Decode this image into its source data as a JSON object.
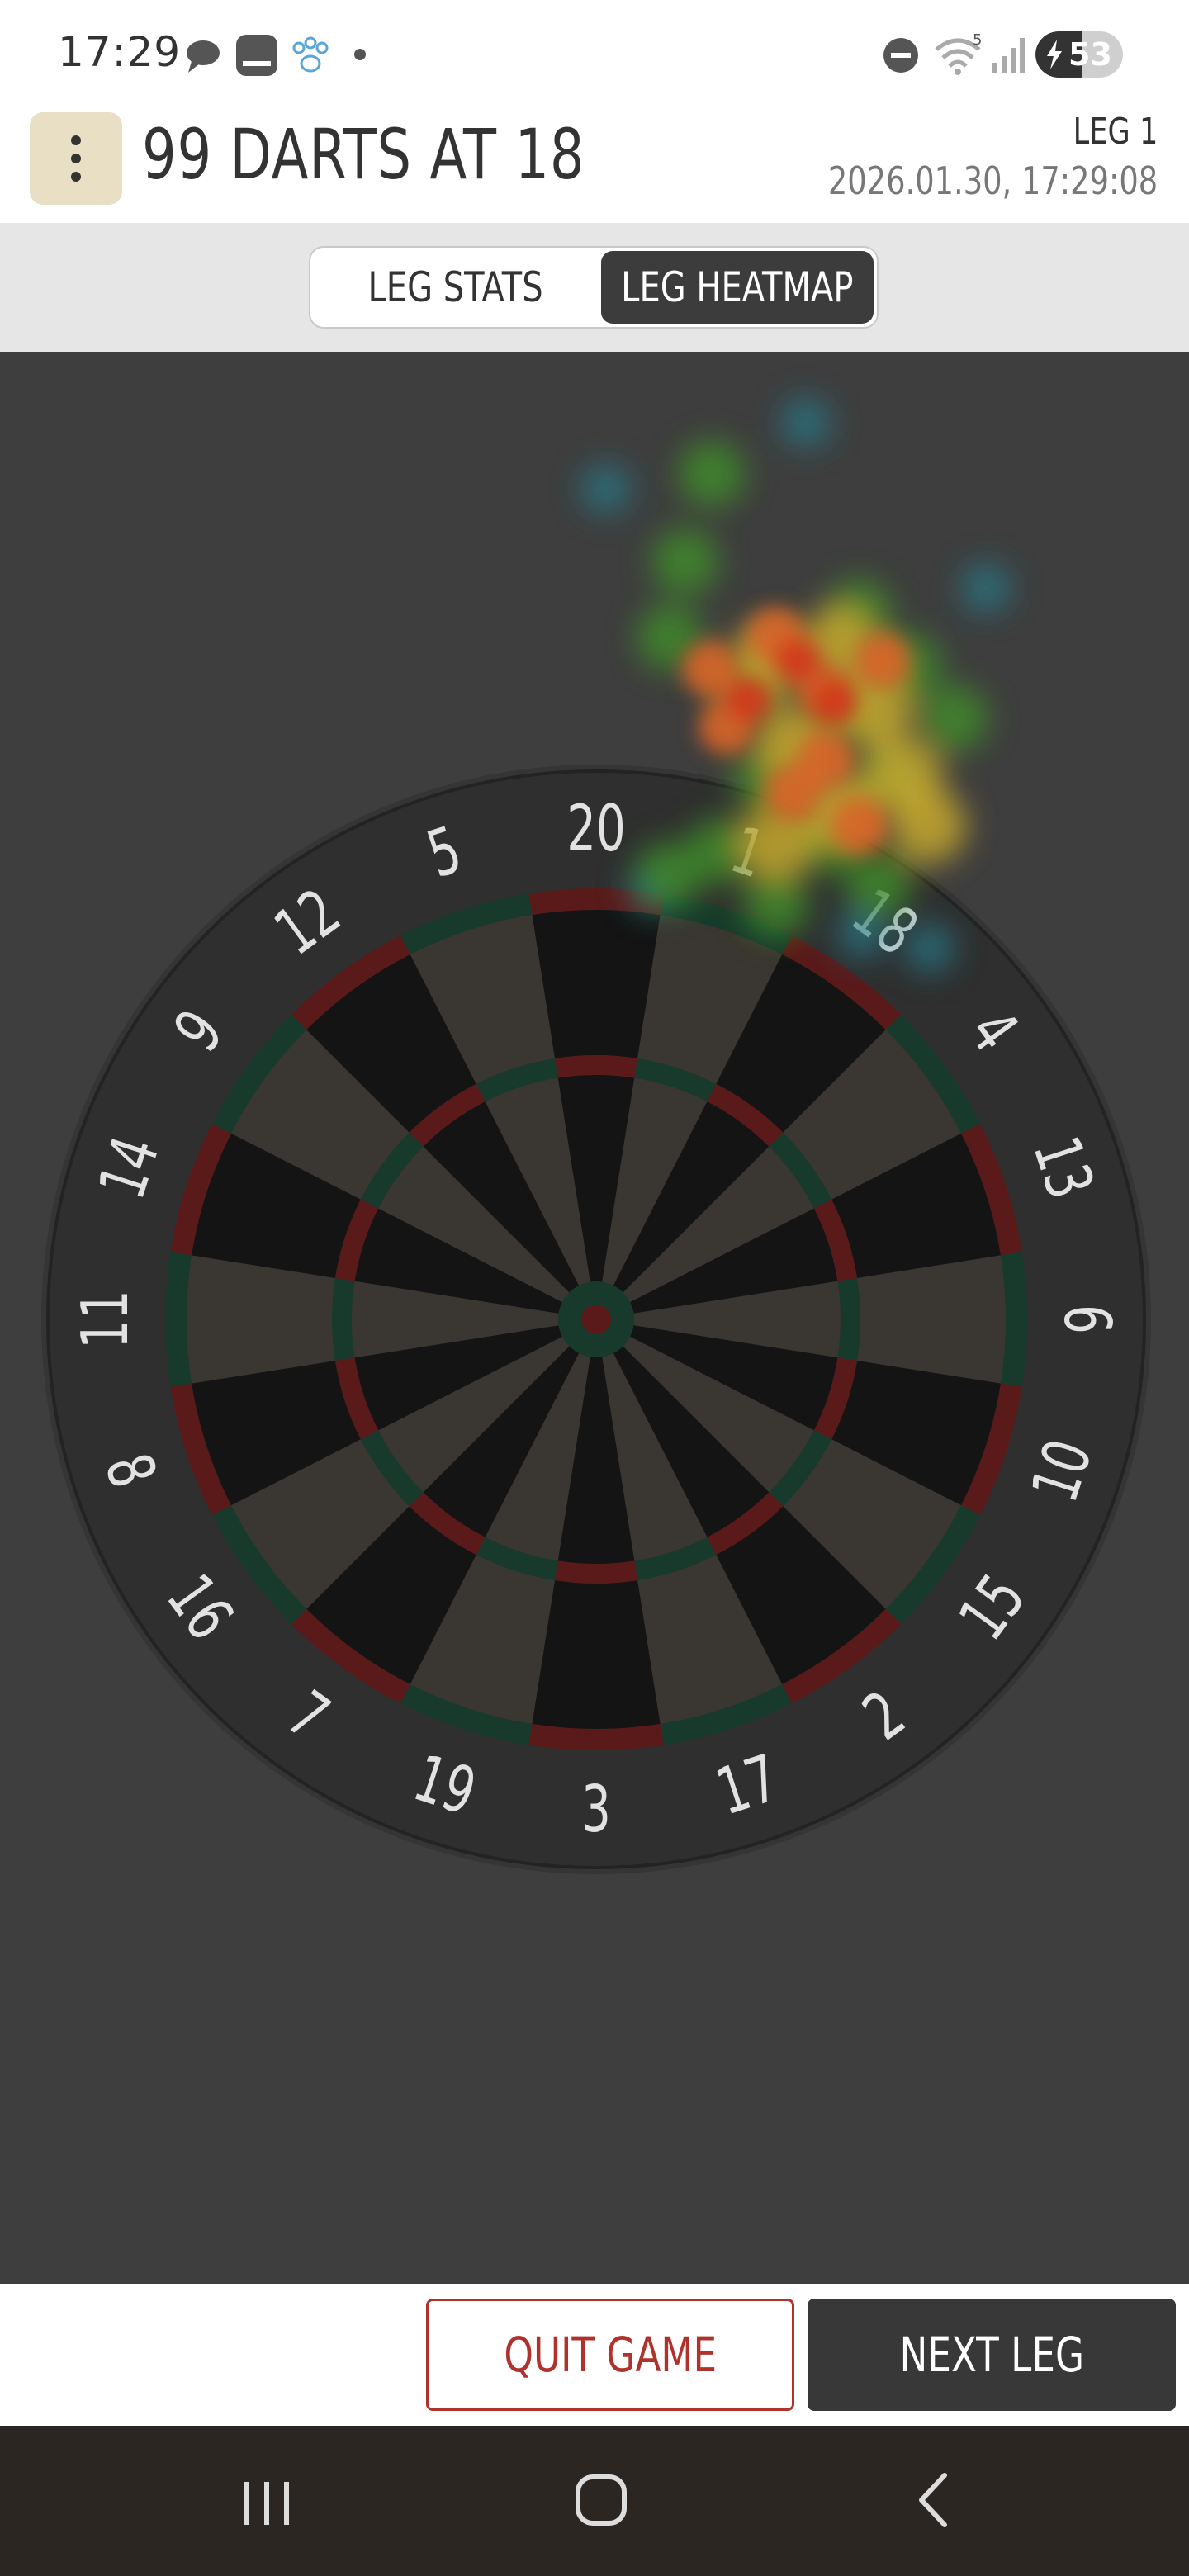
{
  "status_bar": {
    "time": "17:29",
    "battery": "53",
    "wifi_badge": "5",
    "icons": [
      "chat-bubble-icon",
      "gallery-icon",
      "paw-icon",
      "notification-dot-icon",
      "do-not-disturb-icon",
      "wifi-icon",
      "signal-icon",
      "battery-charging-icon"
    ]
  },
  "header": {
    "title": "99 DARTS AT 18",
    "leg": "LEG 1",
    "datetime": "2026.01.30, 17:29:08",
    "menu_icon": "more-vertical-icon"
  },
  "tabs": [
    {
      "label": "LEG STATS",
      "active": false
    },
    {
      "label": "LEG HEATMAP",
      "active": true
    }
  ],
  "dartboard": {
    "numbers": [
      "20",
      "1",
      "18",
      "4",
      "13",
      "6",
      "10",
      "15",
      "2",
      "17",
      "3",
      "19",
      "7",
      "16",
      "8",
      "11",
      "14",
      "9",
      "12",
      "5"
    ],
    "colors": {
      "dark": "#141414",
      "light": "#3a3631",
      "red": "#5a1a1a",
      "green": "#173a2c",
      "ring": "#2f2f2f"
    }
  },
  "footer": {
    "quit_label": "QUIT GAME",
    "next_label": "NEXT LEG",
    "quit_color": "#b0322c"
  },
  "nav_bar": {
    "icons": [
      "recent-apps-icon",
      "home-icon",
      "back-icon"
    ]
  }
}
